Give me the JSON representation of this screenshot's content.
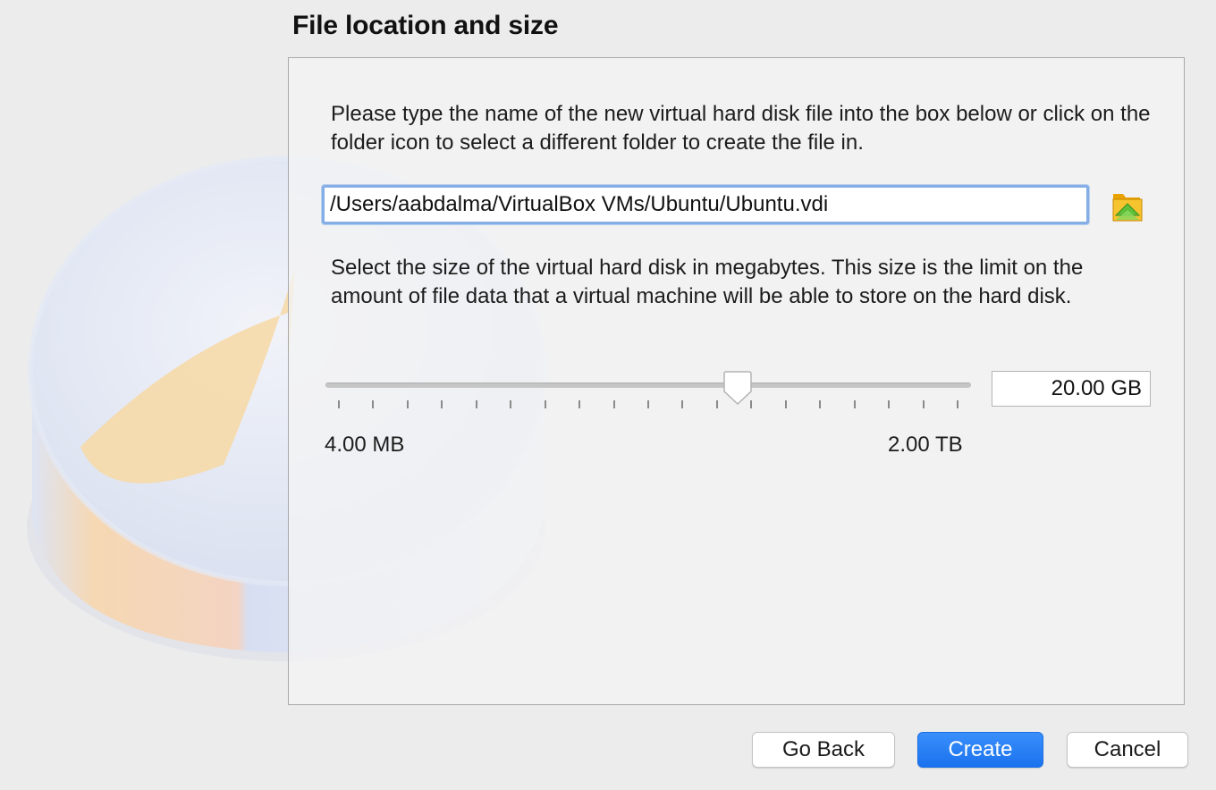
{
  "wizard": {
    "heading": "File location and size"
  },
  "location": {
    "instructions": "Please type the name of the new virtual hard disk file into the box below or click on the folder icon to select a different folder to create the file in.",
    "path_value": "/Users/aabdalma/VirtualBox VMs/Ubuntu/Ubuntu.vdi",
    "folder_icon": "folder-open-icon"
  },
  "size": {
    "instructions": "Select the size of the virtual hard disk in megabytes. This size is the limit on the amount of file data that a virtual machine will be able to store on the hard disk.",
    "value_label": "20.00 GB",
    "min_label": "4.00 MB",
    "max_label": "2.00 TB",
    "slider_fraction": 0.638,
    "tick_count": 19
  },
  "buttons": {
    "back_label": "Go Back",
    "create_label": "Create",
    "cancel_label": "Cancel"
  },
  "colors": {
    "primary_button": "#1a72ee",
    "input_focus": "#85aee6",
    "folder_icon": "#f3b300"
  }
}
